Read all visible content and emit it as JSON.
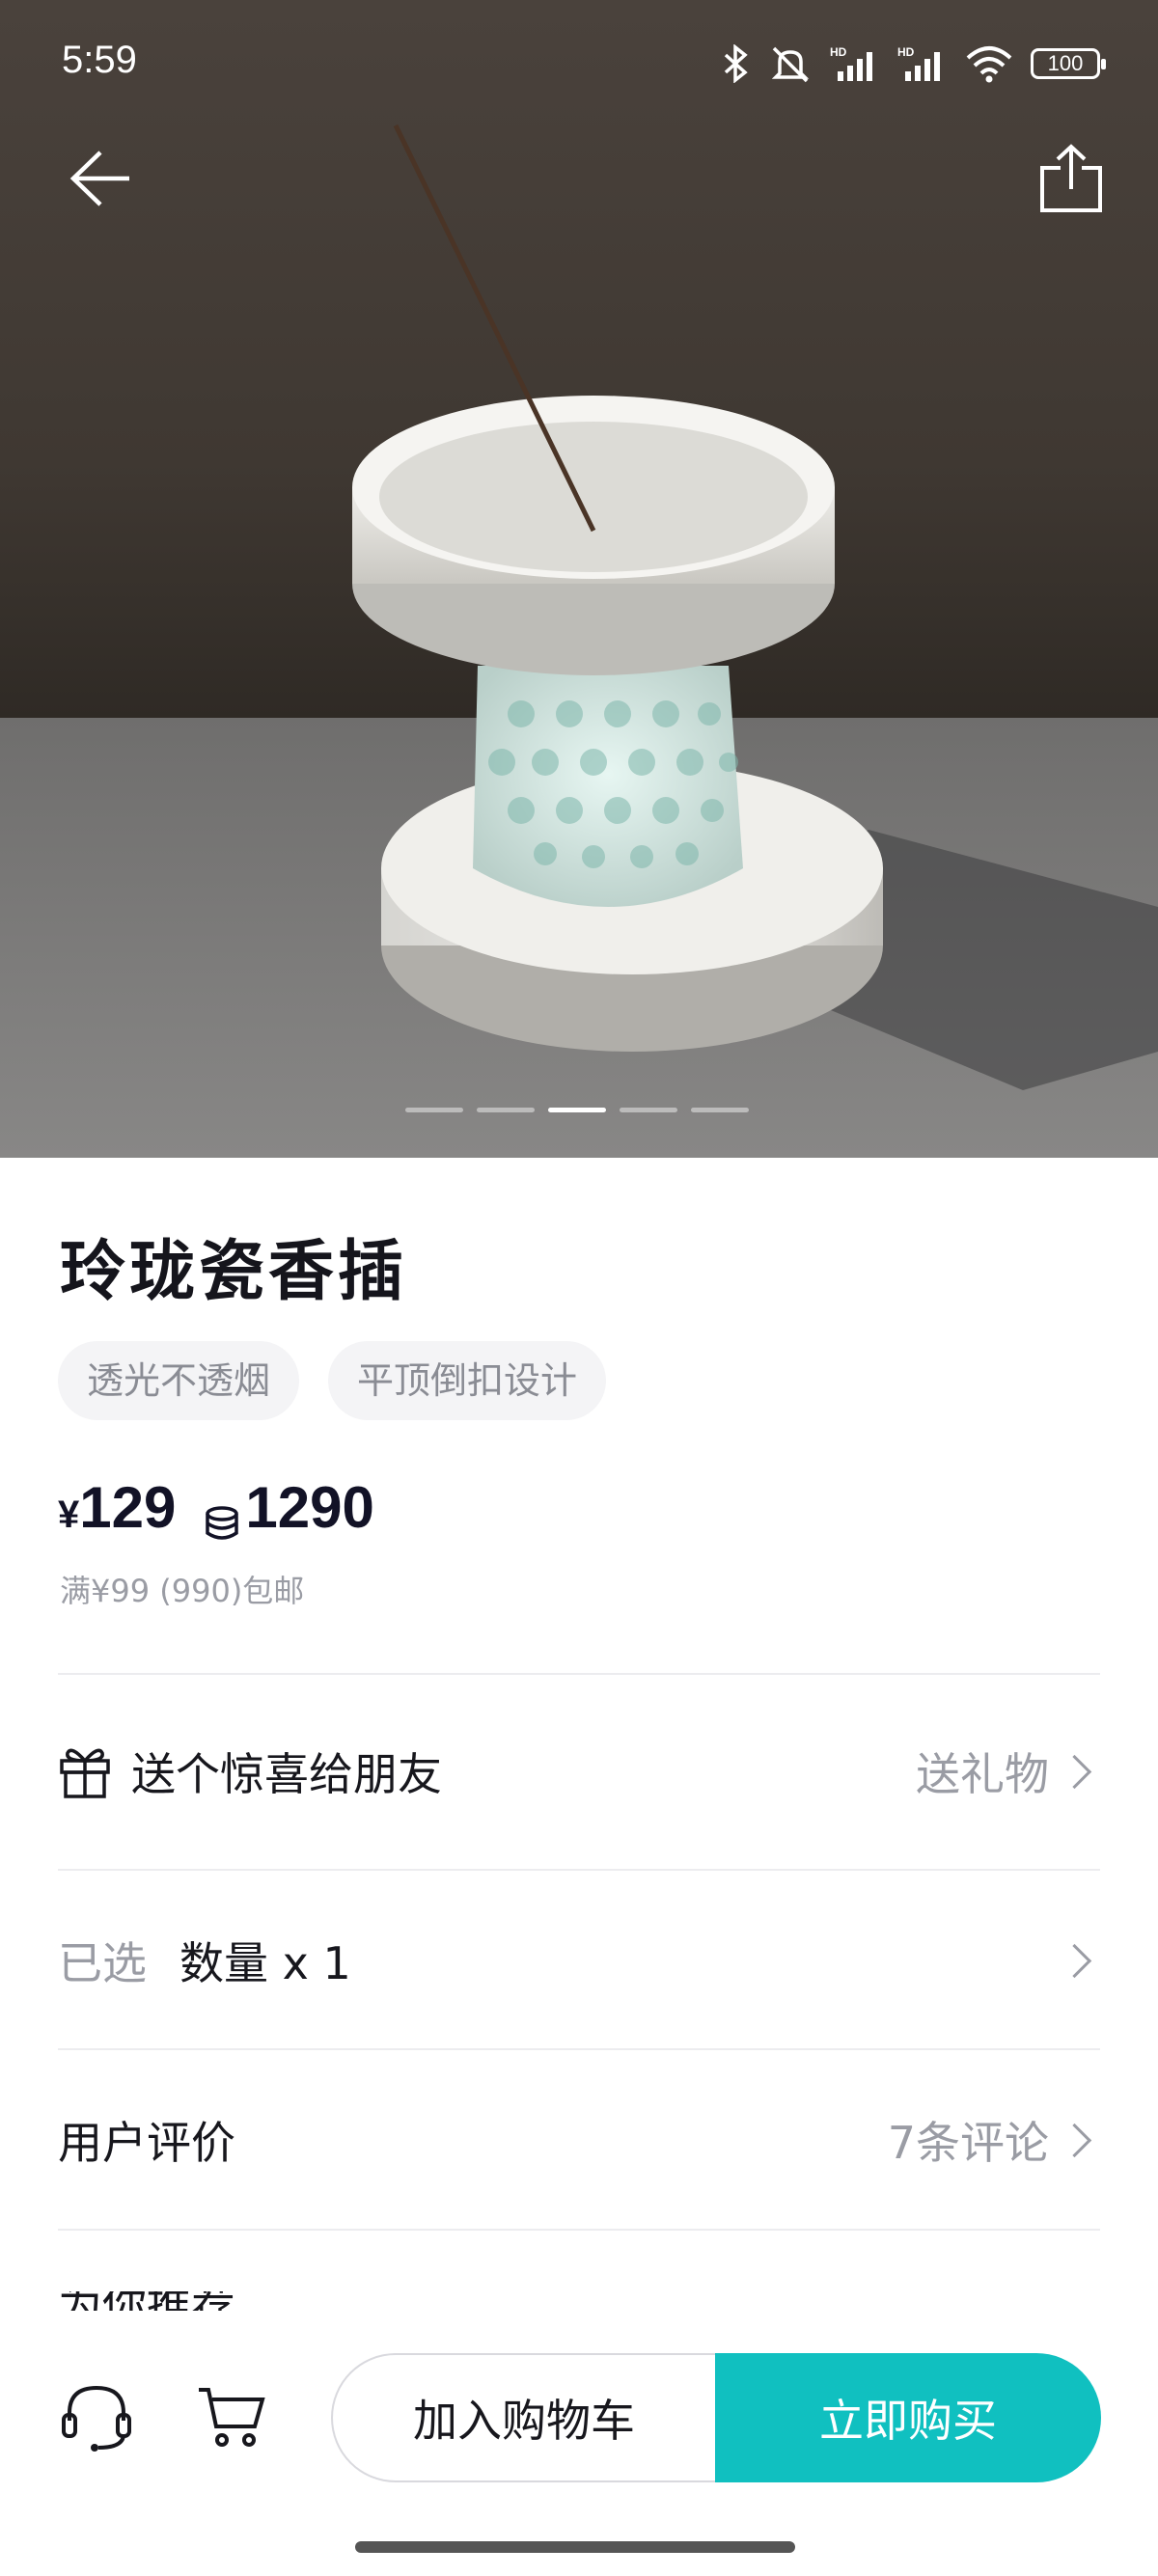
{
  "status_bar": {
    "time": "5:59",
    "battery": "100",
    "icons": [
      "bluetooth-icon",
      "mute-icon",
      "hd-signal-icon",
      "hd-signal-icon",
      "wifi-icon",
      "battery-icon"
    ]
  },
  "header": {
    "back_icon": "arrow-left-icon",
    "share_icon": "share-icon"
  },
  "gallery": {
    "total": 5,
    "active_index": 2
  },
  "product": {
    "title": "玲珑瓷香插",
    "tags": [
      "透光不透烟",
      "平顶倒扣设计"
    ],
    "price_currency": "¥",
    "price": "129",
    "coin_price": "1290",
    "shipping_note": "满¥99 (990)包邮"
  },
  "rows": {
    "gift": {
      "label": "送个惊喜给朋友",
      "action": "送礼物"
    },
    "selected": {
      "prefix": "已选",
      "value": "数量 x 1"
    },
    "reviews": {
      "label": "用户评价",
      "count": "7条评论"
    },
    "partial": {
      "label": "为你推荐"
    }
  },
  "bottom_bar": {
    "add_to_cart": "加入购物车",
    "buy_now": "立即购买"
  },
  "colors": {
    "accent": "#10c0c0",
    "text_primary": "#17171d",
    "text_muted": "#9a9ca4"
  }
}
